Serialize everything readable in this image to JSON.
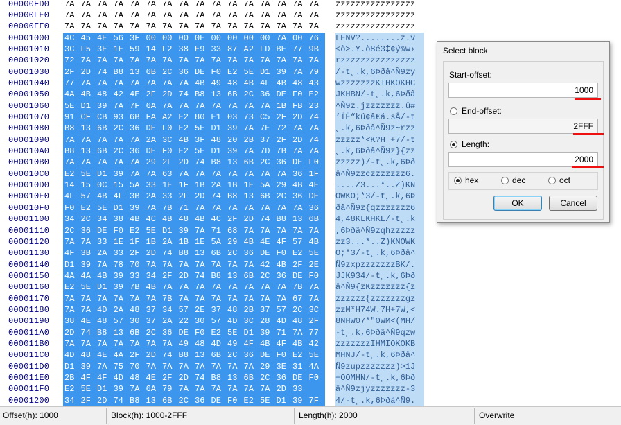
{
  "hex_rows": [
    {
      "offset": "00000FD0",
      "bytes": [
        "7A",
        "7A",
        "7A",
        "7A",
        "7A",
        "7A",
        "7A",
        "7A",
        "7A",
        "7A",
        "7A",
        "7A",
        "7A",
        "7A",
        "7A",
        "7A"
      ],
      "ascii": "zzzzzzzzzzzzzzzz",
      "selected": false
    },
    {
      "offset": "00000FE0",
      "bytes": [
        "7A",
        "7A",
        "7A",
        "7A",
        "7A",
        "7A",
        "7A",
        "7A",
        "7A",
        "7A",
        "7A",
        "7A",
        "7A",
        "7A",
        "7A",
        "7A"
      ],
      "ascii": "zzzzzzzzzzzzzzzz",
      "selected": false
    },
    {
      "offset": "00000FF0",
      "bytes": [
        "7A",
        "7A",
        "7A",
        "7A",
        "7A",
        "7A",
        "7A",
        "7A",
        "7A",
        "7A",
        "7A",
        "7A",
        "7A",
        "7A",
        "7A",
        "7A"
      ],
      "ascii": "zzzzzzzzzzzzzzzz",
      "selected": false
    },
    {
      "offset": "00001000",
      "bytes": [
        "4C",
        "45",
        "4E",
        "56",
        "3F",
        "00",
        "00",
        "00",
        "0E",
        "00",
        "00",
        "00",
        "00",
        "7A",
        "00",
        "76"
      ],
      "ascii": "LENV?........z.v",
      "selected": true
    },
    {
      "offset": "00001010",
      "bytes": [
        "3C",
        "F5",
        "3E",
        "1E",
        "59",
        "14",
        "F2",
        "38",
        "E9",
        "33",
        "87",
        "A2",
        "FD",
        "BE",
        "77",
        "9B"
      ],
      "ascii": "<õ>.Y.ò8é3‡¢ý¾w›",
      "selected": true
    },
    {
      "offset": "00001020",
      "bytes": [
        "72",
        "7A",
        "7A",
        "7A",
        "7A",
        "7A",
        "7A",
        "7A",
        "7A",
        "7A",
        "7A",
        "7A",
        "7A",
        "7A",
        "7A",
        "7A"
      ],
      "ascii": "rzzzzzzzzzzzzzzz",
      "selected": true
    },
    {
      "offset": "00001030",
      "bytes": [
        "2F",
        "2D",
        "74",
        "B8",
        "13",
        "6B",
        "2C",
        "36",
        "DE",
        "F0",
        "E2",
        "5E",
        "D1",
        "39",
        "7A",
        "79"
      ],
      "ascii": "/-t¸.k,6Þðâ^Ñ9zy",
      "selected": true
    },
    {
      "offset": "00001040",
      "bytes": [
        "77",
        "7A",
        "7A",
        "7A",
        "7A",
        "7A",
        "7A",
        "7A",
        "4B",
        "49",
        "48",
        "4B",
        "4F",
        "4B",
        "48",
        "43"
      ],
      "ascii": "wzzzzzzzKIHKOKHC",
      "selected": true
    },
    {
      "offset": "00001050",
      "bytes": [
        "4A",
        "4B",
        "48",
        "42",
        "4E",
        "2F",
        "2D",
        "74",
        "B8",
        "13",
        "6B",
        "2C",
        "36",
        "DE",
        "F0",
        "E2"
      ],
      "ascii": "JKHBN/-t¸.k,6Þðâ",
      "selected": true
    },
    {
      "offset": "00001060",
      "bytes": [
        "5E",
        "D1",
        "39",
        "7A",
        "7F",
        "6A",
        "7A",
        "7A",
        "7A",
        "7A",
        "7A",
        "7A",
        "7A",
        "1B",
        "FB",
        "23"
      ],
      "ascii": "^Ñ9z.jzzzzzzz.û#",
      "selected": true
    },
    {
      "offset": "00001070",
      "bytes": [
        "91",
        "CF",
        "CB",
        "93",
        "6B",
        "FA",
        "A2",
        "E2",
        "80",
        "E1",
        "03",
        "73",
        "C5",
        "2F",
        "2D",
        "74"
      ],
      "ascii": "‘ÏË“kú¢â€á.sÅ/-t",
      "selected": true
    },
    {
      "offset": "00001080",
      "bytes": [
        "B8",
        "13",
        "6B",
        "2C",
        "36",
        "DE",
        "F0",
        "E2",
        "5E",
        "D1",
        "39",
        "7A",
        "7E",
        "72",
        "7A",
        "7A"
      ],
      "ascii": "¸.k,6Þðâ^Ñ9z~rzz",
      "selected": true
    },
    {
      "offset": "00001090",
      "bytes": [
        "7A",
        "7A",
        "7A",
        "7A",
        "7A",
        "2A",
        "3C",
        "4B",
        "3F",
        "48",
        "20",
        "2B",
        "37",
        "2F",
        "2D",
        "74"
      ],
      "ascii": "zzzzz*<K?H +7/-t",
      "selected": true
    },
    {
      "offset": "000010A0",
      "bytes": [
        "B8",
        "13",
        "6B",
        "2C",
        "36",
        "DE",
        "F0",
        "E2",
        "5E",
        "D1",
        "39",
        "7A",
        "7D",
        "7B",
        "7A",
        "7A"
      ],
      "ascii": "¸.k,6Þðâ^Ñ9z}{zz",
      "selected": true
    },
    {
      "offset": "000010B0",
      "bytes": [
        "7A",
        "7A",
        "7A",
        "7A",
        "7A",
        "29",
        "2F",
        "2D",
        "74",
        "B8",
        "13",
        "6B",
        "2C",
        "36",
        "DE",
        "F0"
      ],
      "ascii": "zzzzz)/-t¸.k,6Þð",
      "selected": true
    },
    {
      "offset": "000010C0",
      "bytes": [
        "E2",
        "5E",
        "D1",
        "39",
        "7A",
        "7A",
        "63",
        "7A",
        "7A",
        "7A",
        "7A",
        "7A",
        "7A",
        "7A",
        "36",
        "1F"
      ],
      "ascii": "â^Ñ9zzczzzzzzz6.",
      "selected": true
    },
    {
      "offset": "000010D0",
      "bytes": [
        "14",
        "15",
        "0C",
        "15",
        "5A",
        "33",
        "1E",
        "1F",
        "1B",
        "2A",
        "1B",
        "1E",
        "5A",
        "29",
        "4B",
        "4E"
      ],
      "ascii": "....Z3...*..Z)KN",
      "selected": true
    },
    {
      "offset": "000010E0",
      "bytes": [
        "4F",
        "57",
        "4B",
        "4F",
        "3B",
        "2A",
        "33",
        "2F",
        "2D",
        "74",
        "B8",
        "13",
        "6B",
        "2C",
        "36",
        "DE"
      ],
      "ascii": "OWKO;*3/-t¸.k,6Þ",
      "selected": true
    },
    {
      "offset": "000010F0",
      "bytes": [
        "F0",
        "E2",
        "5E",
        "D1",
        "39",
        "7A",
        "7B",
        "71",
        "7A",
        "7A",
        "7A",
        "7A",
        "7A",
        "7A",
        "7A",
        "36"
      ],
      "ascii": "ðâ^Ñ9z{qzzzzzzz6",
      "selected": true
    },
    {
      "offset": "00001100",
      "bytes": [
        "34",
        "2C",
        "34",
        "38",
        "4B",
        "4C",
        "4B",
        "48",
        "4B",
        "4C",
        "2F",
        "2D",
        "74",
        "B8",
        "13",
        "6B"
      ],
      "ascii": "4,48KLKHKL/-t¸.k",
      "selected": true
    },
    {
      "offset": "00001110",
      "bytes": [
        "2C",
        "36",
        "DE",
        "F0",
        "E2",
        "5E",
        "D1",
        "39",
        "7A",
        "71",
        "68",
        "7A",
        "7A",
        "7A",
        "7A",
        "7A"
      ],
      "ascii": ",6Þðâ^Ñ9zqhzzzzz",
      "selected": true
    },
    {
      "offset": "00001120",
      "bytes": [
        "7A",
        "7A",
        "33",
        "1E",
        "1F",
        "1B",
        "2A",
        "1B",
        "1E",
        "5A",
        "29",
        "4B",
        "4E",
        "4F",
        "57",
        "4B"
      ],
      "ascii": "zz3...*..Z)KNOWK",
      "selected": true
    },
    {
      "offset": "00001130",
      "bytes": [
        "4F",
        "3B",
        "2A",
        "33",
        "2F",
        "2D",
        "74",
        "B8",
        "13",
        "6B",
        "2C",
        "36",
        "DE",
        "F0",
        "E2",
        "5E"
      ],
      "ascii": "O;*3/-t¸.k,6Þðâ^",
      "selected": true
    },
    {
      "offset": "00001140",
      "bytes": [
        "D1",
        "39",
        "7A",
        "78",
        "70",
        "7A",
        "7A",
        "7A",
        "7A",
        "7A",
        "7A",
        "7A",
        "42",
        "4B",
        "2F",
        "2E"
      ],
      "ascii": "Ñ9zxpzzzzzzzBK/.",
      "selected": true
    },
    {
      "offset": "00001150",
      "bytes": [
        "4A",
        "4A",
        "4B",
        "39",
        "33",
        "34",
        "2F",
        "2D",
        "74",
        "B8",
        "13",
        "6B",
        "2C",
        "36",
        "DE",
        "F0"
      ],
      "ascii": "JJK934/-t¸.k,6Þð",
      "selected": true
    },
    {
      "offset": "00001160",
      "bytes": [
        "E2",
        "5E",
        "D1",
        "39",
        "7B",
        "4B",
        "7A",
        "7A",
        "7A",
        "7A",
        "7A",
        "7A",
        "7A",
        "7A",
        "7B",
        "7A"
      ],
      "ascii": "â^Ñ9{zKzzzzzzz{z",
      "selected": true
    },
    {
      "offset": "00001170",
      "bytes": [
        "7A",
        "7A",
        "7A",
        "7A",
        "7A",
        "7A",
        "7B",
        "7A",
        "7A",
        "7A",
        "7A",
        "7A",
        "7A",
        "7A",
        "67",
        "7A"
      ],
      "ascii": "zzzzzz{zzzzzzzgz",
      "selected": true
    },
    {
      "offset": "00001180",
      "bytes": [
        "7A",
        "7A",
        "4D",
        "2A",
        "48",
        "37",
        "34",
        "57",
        "2E",
        "37",
        "48",
        "2B",
        "37",
        "57",
        "2C",
        "3C"
      ],
      "ascii": "zzM*H74W.7H+7W,<",
      "selected": true
    },
    {
      "offset": "00001190",
      "bytes": [
        "38",
        "4E",
        "48",
        "57",
        "30",
        "37",
        "2A",
        "22",
        "30",
        "57",
        "4D",
        "3C",
        "28",
        "4D",
        "48",
        "2F"
      ],
      "ascii": "8NHW07*\"0WM<(MH/",
      "selected": true
    },
    {
      "offset": "000011A0",
      "bytes": [
        "2D",
        "74",
        "B8",
        "13",
        "6B",
        "2C",
        "36",
        "DE",
        "F0",
        "E2",
        "5E",
        "D1",
        "39",
        "71",
        "7A",
        "77"
      ],
      "ascii": "-t¸.k,6Þðâ^Ñ9qzw",
      "selected": true
    },
    {
      "offset": "000011B0",
      "bytes": [
        "7A",
        "7A",
        "7A",
        "7A",
        "7A",
        "7A",
        "7A",
        "49",
        "48",
        "4D",
        "49",
        "4F",
        "4B",
        "4F",
        "4B",
        "42"
      ],
      "ascii": "zzzzzzzIHMIOKOKB",
      "selected": true
    },
    {
      "offset": "000011C0",
      "bytes": [
        "4D",
        "48",
        "4E",
        "4A",
        "2F",
        "2D",
        "74",
        "B8",
        "13",
        "6B",
        "2C",
        "36",
        "DE",
        "F0",
        "E2",
        "5E"
      ],
      "ascii": "MHNJ/-t¸.k,6Þðâ^",
      "selected": true
    },
    {
      "offset": "000011D0",
      "bytes": [
        "D1",
        "39",
        "7A",
        "75",
        "70",
        "7A",
        "7A",
        "7A",
        "7A",
        "7A",
        "7A",
        "7A",
        "29",
        "3E",
        "31",
        "4A"
      ],
      "ascii": "Ñ9zupzzzzzzz)>1J",
      "selected": true
    },
    {
      "offset": "000011E0",
      "bytes": [
        "2B",
        "4F",
        "4F",
        "4D",
        "48",
        "4E",
        "2F",
        "2D",
        "74",
        "B8",
        "13",
        "6B",
        "2C",
        "36",
        "DE",
        "F0"
      ],
      "ascii": "+OOMHN/-t¸.k,6Þð",
      "selected": true
    },
    {
      "offset": "000011F0",
      "bytes": [
        "E2",
        "5E",
        "D1",
        "39",
        "7A",
        "6A",
        "79",
        "7A",
        "7A",
        "7A",
        "7A",
        "7A",
        "7A",
        "2D",
        "33"
      ],
      "ascii": "â^Ñ9zjyzzzzzzz-3",
      "selected": true
    },
    {
      "offset": "00001200",
      "bytes": [
        "34",
        "2F",
        "2D",
        "74",
        "B8",
        "13",
        "6B",
        "2C",
        "36",
        "DE",
        "F0",
        "E2",
        "5E",
        "D1",
        "39",
        "7F"
      ],
      "ascii": "4/-t¸.k,6Þðâ^Ñ9.",
      "selected": true
    }
  ],
  "dialog": {
    "title": "Select block",
    "start_label": "Start-offset:",
    "start_value": "1000",
    "end_label": "End-offset:",
    "end_value": "2FFF",
    "length_label": "Length:",
    "length_value": "2000",
    "mode_selected": "length",
    "bases": [
      "hex",
      "dec",
      "oct"
    ],
    "base_selected": "hex",
    "ok_label": "OK",
    "cancel_label": "Cancel",
    "annotation_color": "#e11111"
  },
  "status": {
    "offset": "Offset(h): 1000",
    "block": "Block(h): 1000-2FFF",
    "length": "Length(h): 2000",
    "mode": "Overwrite"
  },
  "colors": {
    "selection": "#3d96ee",
    "ascii_selection": "#bfdcf7",
    "offset_text": "#000080"
  }
}
